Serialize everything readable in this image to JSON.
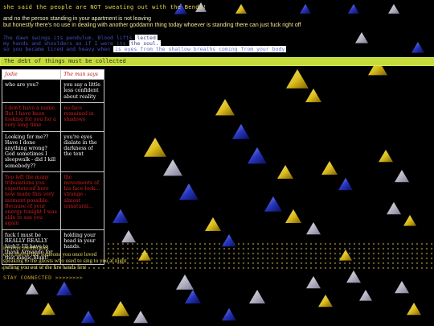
{
  "header": {
    "top_line": "she said the people are NOT sweating out with the Bends!",
    "line_a": "and no the person standing in your apartment is not leaving",
    "line_b": "but honestly there's no use in dealing with another goddamn thing today whoever is standing there can just fuck right off"
  },
  "quote": {
    "row1_dark": "The dawn swings its pendulum. Blood lifts ",
    "row1_box": "lected",
    "row2_dark": "my hands and shoulders as if I were its ",
    "row2_box": "the soul.",
    "row3_dark": "so you became tired and heavy when ",
    "row3_box": "is eyes from the shallow breaths coming from your body"
  },
  "banner": {
    "text": "The debt of things must be collected"
  },
  "dialog": {
    "header_left": "Jodie",
    "header_right": "The man says",
    "rows": [
      {
        "left": "who are you?",
        "right": "you say a little less confident about reality",
        "left_color": "white",
        "right_color": "white"
      },
      {
        "left": "I don't have a name. But I have been looking for you for a very long time",
        "right": "no face remained in shadows",
        "left_color": "red",
        "right_color": "red"
      },
      {
        "left": "Looking for me?? Have I done anything wrong? God sometimes I sleepwalk - did I kill somebody??",
        "right": "you're eyes dialate in the darkness of the tent",
        "left_color": "white",
        "right_color": "white"
      },
      {
        "left": "You left the many tribulations you experienced here now made this very moment possible. Because of your energy tonight I was able to see you again",
        "right": "the movements of his face look... strange - almost unnatural...",
        "left_color": "red",
        "right_color": "red"
      },
      {
        "left": "fuck I must be REALLY REALLY high!! I'll have to thank Armando for that magic blunt!",
        "right": "holding your head in your hands.",
        "left_color": "white",
        "right_color": "white"
      }
    ]
  },
  "tail": {
    "line1": "ice over membranes",
    "line2": "eyes maybe like someone you once loved",
    "line3": "speaking to the ghosts who used to sing to you at night",
    "line4": "pulling you out of the fire hands first"
  },
  "footer": {
    "link_text": "STAY CONNECTED >>>>>>>>"
  },
  "colors": {
    "banner": "#c6dc3c",
    "triangle_yellow": "#f0d020",
    "triangle_blue": "#2a3ad0",
    "background": "#000000"
  }
}
